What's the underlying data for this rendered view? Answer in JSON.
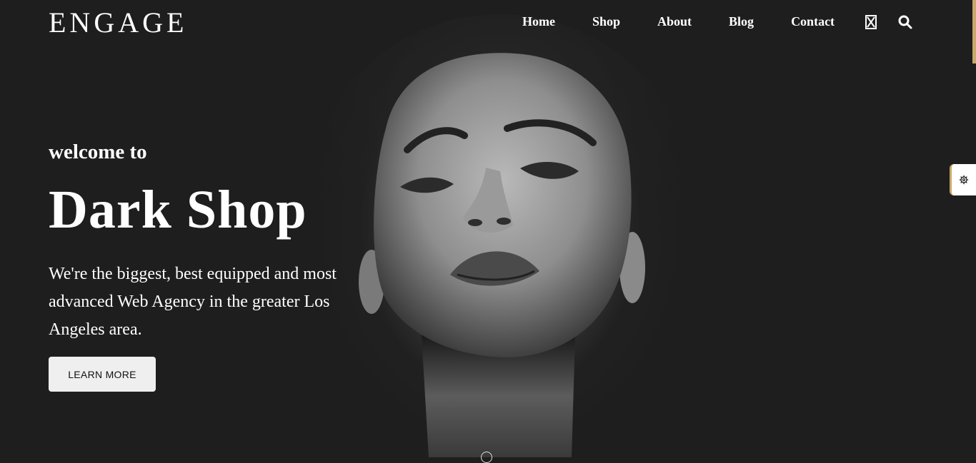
{
  "brand": {
    "logo_text": "ENGAGE"
  },
  "nav": {
    "items": [
      {
        "label": "Home"
      },
      {
        "label": "Shop"
      },
      {
        "label": "About"
      },
      {
        "label": "Blog"
      },
      {
        "label": "Contact"
      }
    ],
    "icons": [
      "hourglass-icon",
      "search-icon"
    ]
  },
  "hero": {
    "kicker": "welcome to",
    "title": "Dark Shop",
    "description": "We're the biggest, best equipped and most advanced Web Agency in the greater Los Angeles area.",
    "cta_label": "LEARN MORE"
  },
  "side_panel": {
    "icon": "gear-icon"
  },
  "colors": {
    "background": "#1e1e1e",
    "accent": "#c8a96a",
    "button_bg": "#efefef"
  }
}
